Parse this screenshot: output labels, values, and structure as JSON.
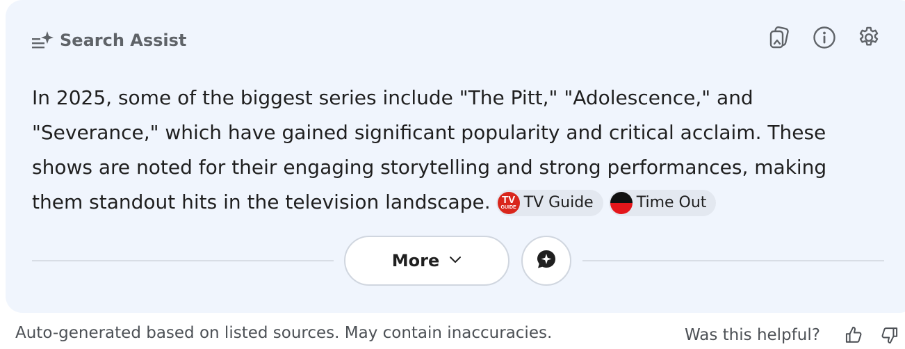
{
  "header": {
    "title": "Search Assist",
    "icon": "sparkle-list-icon"
  },
  "actions": [
    {
      "name": "copy-sources-icon"
    },
    {
      "name": "info-icon"
    },
    {
      "name": "settings-icon"
    }
  ],
  "summary": {
    "text": "In 2025, some of the biggest series include \"The Pitt,\" \"Adolescence,\" and \"Severance,\" which have gained significant popularity and critical acclaim. These shows are noted for their engaging storytelling and strong performances, making them standout hits in the television landscape.",
    "sources": [
      {
        "label": "TV Guide",
        "logo_text": "TV",
        "logo_subtext": "GUIDE",
        "logo_color": "#d9261c"
      },
      {
        "label": "Time Out",
        "logo_colors": [
          "#111111",
          "#e4161b"
        ]
      }
    ]
  },
  "controls": {
    "more_label": "More",
    "chat_icon": "chat-sparkle-icon"
  },
  "footer": {
    "disclaimer": "Auto-generated based on listed sources. May contain inaccuracies.",
    "feedback_label": "Was this helpful?"
  },
  "colors": {
    "card_background": "#f0f5fd",
    "text_primary": "#1f1f1f",
    "text_secondary": "#5f6368",
    "chip_background": "#e3e8f0"
  }
}
